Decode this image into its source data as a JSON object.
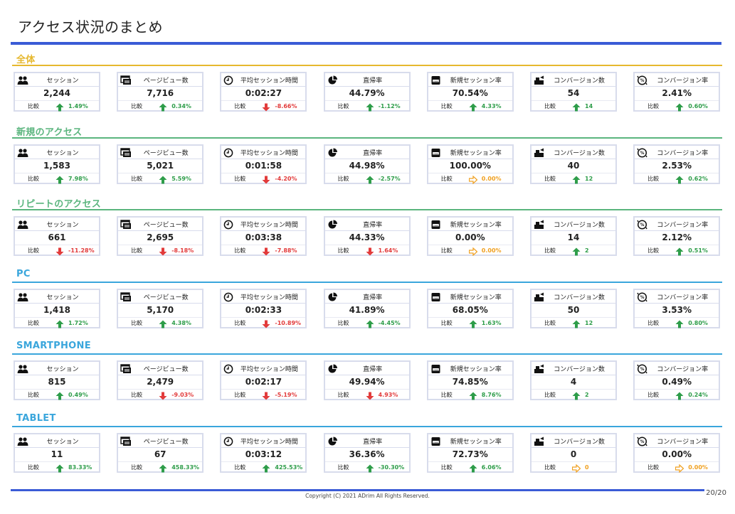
{
  "title": "アクセス状況のまとめ",
  "compare_label": "比較",
  "copyright": "Copyright (C) 2021 ADrim All Rights Reserved.",
  "page_number": "20/20",
  "colors": {
    "up": "#2e9d4a",
    "down": "#e23b3b",
    "flat": "#f0a020",
    "accent": "#3a5bd6"
  },
  "metrics": [
    {
      "label": "セッション",
      "icon": "users-icon"
    },
    {
      "label": "ページビュー数",
      "icon": "pageview-icon"
    },
    {
      "label": "平均セッション時間",
      "icon": "clock-icon"
    },
    {
      "label": "直帰率",
      "icon": "pie-icon"
    },
    {
      "label": "新規セッション率",
      "icon": "new-session-icon"
    },
    {
      "label": "コンバージョン数",
      "icon": "conversion-icon"
    },
    {
      "label": "コンバージョン率",
      "icon": "percent-icon"
    }
  ],
  "sections": [
    {
      "title": "全体",
      "color": "#e6b82e",
      "cards": [
        {
          "value": "2,244",
          "diff": "1.49%",
          "trend": "up"
        },
        {
          "value": "7,716",
          "diff": "0.34%",
          "trend": "up"
        },
        {
          "value": "0:02:27",
          "diff": "-8.66%",
          "trend": "down"
        },
        {
          "value": "44.79%",
          "diff": "-1.12%",
          "trend": "up"
        },
        {
          "value": "70.54%",
          "diff": "4.33%",
          "trend": "up"
        },
        {
          "value": "54",
          "diff": "14",
          "trend": "up"
        },
        {
          "value": "2.41%",
          "diff": "0.60%",
          "trend": "up"
        }
      ]
    },
    {
      "title": "新規のアクセス",
      "color": "#5bb57e",
      "cards": [
        {
          "value": "1,583",
          "diff": "7.98%",
          "trend": "up"
        },
        {
          "value": "5,021",
          "diff": "5.59%",
          "trend": "up"
        },
        {
          "value": "0:01:58",
          "diff": "-4.20%",
          "trend": "down"
        },
        {
          "value": "44.98%",
          "diff": "-2.57%",
          "trend": "up"
        },
        {
          "value": "100.00%",
          "diff": "0.00%",
          "trend": "flat"
        },
        {
          "value": "40",
          "diff": "12",
          "trend": "up"
        },
        {
          "value": "2.53%",
          "diff": "0.62%",
          "trend": "up"
        }
      ]
    },
    {
      "title": "リピートのアクセス",
      "color": "#5bb57e",
      "cards": [
        {
          "value": "661",
          "diff": "-11.28%",
          "trend": "down"
        },
        {
          "value": "2,695",
          "diff": "-8.18%",
          "trend": "down"
        },
        {
          "value": "0:03:38",
          "diff": "-7.88%",
          "trend": "down"
        },
        {
          "value": "44.33%",
          "diff": "1.64%",
          "trend": "down"
        },
        {
          "value": "0.00%",
          "diff": "0.00%",
          "trend": "flat"
        },
        {
          "value": "14",
          "diff": "2",
          "trend": "up"
        },
        {
          "value": "2.12%",
          "diff": "0.51%",
          "trend": "up"
        }
      ]
    },
    {
      "title": "PC",
      "color": "#3aa6dc",
      "cards": [
        {
          "value": "1,418",
          "diff": "1.72%",
          "trend": "up"
        },
        {
          "value": "5,170",
          "diff": "4.38%",
          "trend": "up"
        },
        {
          "value": "0:02:33",
          "diff": "-10.89%",
          "trend": "down"
        },
        {
          "value": "41.89%",
          "diff": "-4.45%",
          "trend": "up"
        },
        {
          "value": "68.05%",
          "diff": "1.63%",
          "trend": "up"
        },
        {
          "value": "50",
          "diff": "12",
          "trend": "up"
        },
        {
          "value": "3.53%",
          "diff": "0.80%",
          "trend": "up"
        }
      ]
    },
    {
      "title": "SMARTPHONE",
      "color": "#3aa6dc",
      "cards": [
        {
          "value": "815",
          "diff": "0.49%",
          "trend": "up"
        },
        {
          "value": "2,479",
          "diff": "-9.03%",
          "trend": "down"
        },
        {
          "value": "0:02:17",
          "diff": "-5.19%",
          "trend": "down"
        },
        {
          "value": "49.94%",
          "diff": "4.93%",
          "trend": "down"
        },
        {
          "value": "74.85%",
          "diff": "8.76%",
          "trend": "up"
        },
        {
          "value": "4",
          "diff": "2",
          "trend": "up"
        },
        {
          "value": "0.49%",
          "diff": "0.24%",
          "trend": "up"
        }
      ]
    },
    {
      "title": "TABLET",
      "color": "#3aa6dc",
      "cards": [
        {
          "value": "11",
          "diff": "83.33%",
          "trend": "up"
        },
        {
          "value": "67",
          "diff": "458.33%",
          "trend": "up"
        },
        {
          "value": "0:03:12",
          "diff": "425.53%",
          "trend": "up"
        },
        {
          "value": "36.36%",
          "diff": "-30.30%",
          "trend": "up"
        },
        {
          "value": "72.73%",
          "diff": "6.06%",
          "trend": "up"
        },
        {
          "value": "0",
          "diff": "0",
          "trend": "flat"
        },
        {
          "value": "0.00%",
          "diff": "0.00%",
          "trend": "flat"
        }
      ]
    }
  ]
}
